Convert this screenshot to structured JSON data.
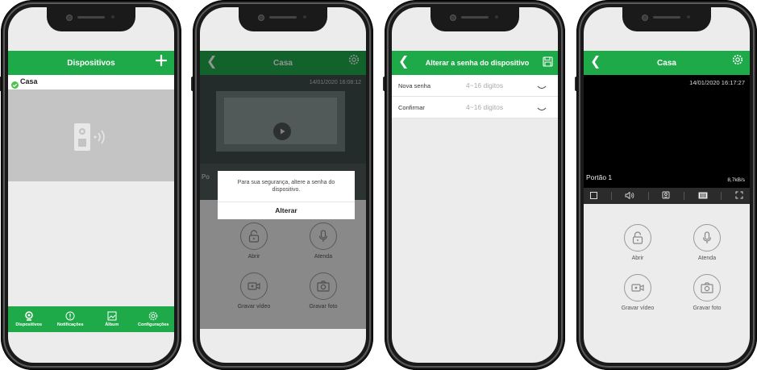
{
  "colors": {
    "accent": "#1faa4a",
    "frame": "#1a1a1a",
    "screen_bg": "#ececec"
  },
  "phone1": {
    "title": "Dispositivos",
    "add_icon": "plus-icon",
    "device_name": "Casa",
    "nav": [
      {
        "label": "Dispositivos",
        "icon": "camera-icon"
      },
      {
        "label": "Notificações",
        "icon": "alert-icon"
      },
      {
        "label": "Álbum",
        "icon": "image-icon"
      },
      {
        "label": "Configurações",
        "icon": "gear-icon"
      }
    ]
  },
  "phone2": {
    "title": "Casa",
    "timestamp": "14/01/2020 16:08:12",
    "camera_label": "Po",
    "dialog_message": "Para sua segurança, altere a senha do dispositivo.",
    "dialog_button": "Alterar",
    "actions": [
      {
        "label": "Abrir",
        "icon": "lock-icon"
      },
      {
        "label": "Atenda",
        "icon": "microphone-icon"
      },
      {
        "label": "Gravar vídeo",
        "icon": "video-icon"
      },
      {
        "label": "Gravar foto",
        "icon": "camera-icon"
      }
    ]
  },
  "phone3": {
    "title": "Alterar a senha do dispositivo",
    "save_icon": "save-icon",
    "fields": [
      {
        "label": "Nova senha",
        "placeholder": "4~16 digitos"
      },
      {
        "label": "Confirmar",
        "placeholder": "4~16 digitos"
      }
    ]
  },
  "phone4": {
    "title": "Casa",
    "timestamp": "14/01/2020 16:17:27",
    "camera_label": "Portão 1",
    "bitrate": "8,7kB/s",
    "toolbar_icons": [
      "stop-icon",
      "speaker-icon",
      "intercom-icon",
      "quality-icon",
      "fullscreen-icon"
    ],
    "actions": [
      {
        "label": "Abrir",
        "icon": "lock-icon"
      },
      {
        "label": "Atenda",
        "icon": "microphone-icon"
      },
      {
        "label": "Gravar vídeo",
        "icon": "video-icon"
      },
      {
        "label": "Gravar foto",
        "icon": "camera-icon"
      }
    ]
  }
}
